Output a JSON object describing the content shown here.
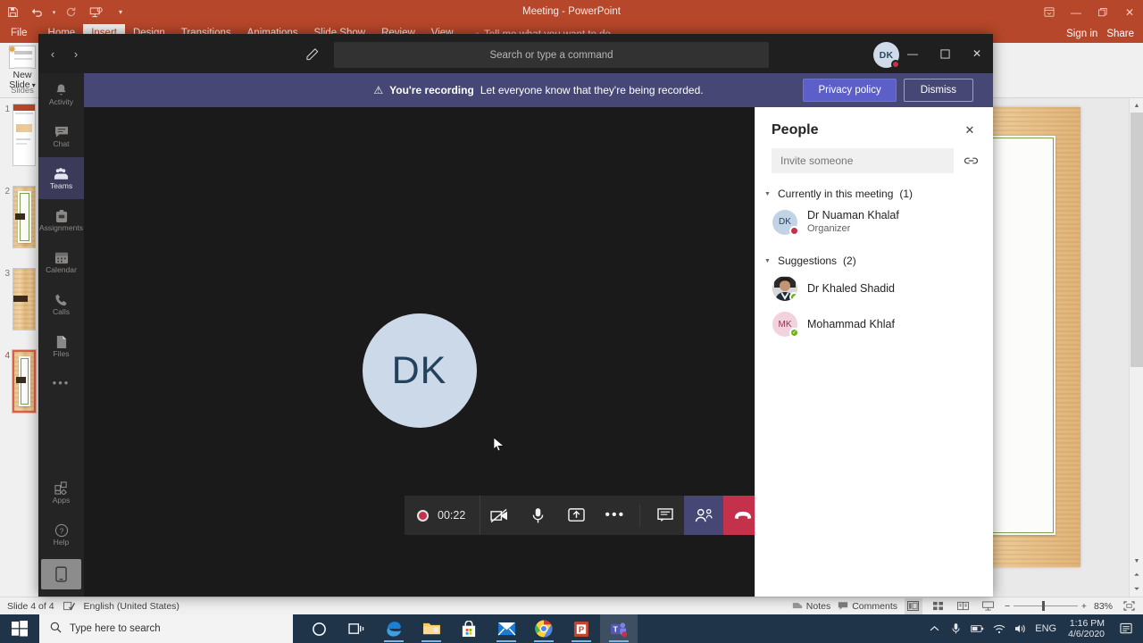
{
  "powerpoint": {
    "title": "Meeting - PowerPoint",
    "quick_access": [
      "save-icon",
      "undo-icon",
      "redo-icon",
      "start-presentation-icon",
      "customize-qat-icon"
    ],
    "window_controls": [
      "ribbon-display-options-icon",
      "minimize-icon",
      "restore-icon",
      "close-icon"
    ],
    "ribbon_tabs": [
      {
        "label": "File",
        "active": false
      },
      {
        "label": "Home",
        "active": false
      },
      {
        "label": "Insert",
        "active": true
      },
      {
        "label": "Design",
        "active": false
      },
      {
        "label": "Transitions",
        "active": false
      },
      {
        "label": "Animations",
        "active": false
      },
      {
        "label": "Slide Show",
        "active": false
      },
      {
        "label": "Review",
        "active": false
      },
      {
        "label": "View",
        "active": false
      }
    ],
    "tell_me": "Tell me what you want to do...",
    "sign_in": "Sign in",
    "share": "Share",
    "new_slide_label_1": "New",
    "new_slide_label_2": "Slide",
    "slides_group_label": "Slides",
    "thumbnails": [
      {
        "number": "1",
        "selected": false
      },
      {
        "number": "2",
        "selected": false
      },
      {
        "number": "3",
        "selected": false
      },
      {
        "number": "4",
        "selected": true
      }
    ],
    "status": {
      "slide_counter": "Slide 4 of 4",
      "language": "English (United States)",
      "notes": "Notes",
      "comments": "Comments",
      "zoom_level": "83%",
      "view_buttons": [
        "normal-view-icon",
        "slide-sorter-icon",
        "reading-view-icon",
        "slideshow-icon"
      ],
      "zoom_out": "−",
      "zoom_in": "+",
      "fit_slide": "fit-to-window-icon"
    }
  },
  "teams": {
    "nav": {
      "back": "back-arrow-icon",
      "forward": "forward-arrow-icon",
      "compose": "compose-icon"
    },
    "search": {
      "placeholder": "Search or type a command",
      "value": ""
    },
    "avatar": {
      "initials": "DK",
      "presence": "busy"
    },
    "window_controls": [
      "minimize-icon",
      "maximize-icon",
      "close-icon"
    ],
    "recording_banner": {
      "warning_icon": "warning-icon",
      "bold_text": "You're recording",
      "text": "Let everyone know that they're being recorded.",
      "privacy_button": "Privacy policy",
      "dismiss_button": "Dismiss",
      "accent_color": "#464775",
      "privacy_button_color": "#5b5fc7"
    },
    "rail": [
      {
        "label": "Activity",
        "icon": "bell-icon",
        "active": false
      },
      {
        "label": "Chat",
        "icon": "chat-icon",
        "active": false
      },
      {
        "label": "Teams",
        "icon": "teams-icon",
        "active": true
      },
      {
        "label": "Assignments",
        "icon": "assignments-icon",
        "active": false
      },
      {
        "label": "Calendar",
        "icon": "calendar-icon",
        "active": false
      },
      {
        "label": "Calls",
        "icon": "phone-icon",
        "active": false
      },
      {
        "label": "Files",
        "icon": "files-icon",
        "active": false
      },
      {
        "label": "",
        "icon": "more-options-icon",
        "active": false
      }
    ],
    "rail_bottom": [
      {
        "label": "Apps",
        "icon": "apps-icon"
      },
      {
        "label": "Help",
        "icon": "help-icon"
      }
    ],
    "rail_tile_icon": "mobile-download-icon",
    "stage": {
      "avatar_initials": "DK"
    },
    "controls": {
      "recording_time": "00:22",
      "recording_indicator": "recording-dot-icon",
      "buttons": [
        {
          "name": "camera-off-button",
          "icon": "camera-off-icon"
        },
        {
          "name": "microphone-button",
          "icon": "microphone-icon"
        },
        {
          "name": "share-screen-button",
          "icon": "share-screen-icon"
        },
        {
          "name": "more-actions-button",
          "icon": "ellipsis-icon"
        },
        {
          "name": "chat-button",
          "icon": "conversation-icon"
        },
        {
          "name": "people-button",
          "icon": "people-icon"
        },
        {
          "name": "hangup-button",
          "icon": "hangup-icon"
        }
      ],
      "people_button_color": "#464775",
      "hangup_button_color": "#c4314b"
    },
    "people_panel": {
      "title": "People",
      "close_icon": "close-icon",
      "invite_placeholder": "Invite someone",
      "invite_value": "",
      "share_link_icon": "share-link-icon",
      "sections": [
        {
          "label": "Currently in this meeting",
          "count": "(1)",
          "people": [
            {
              "name": "Dr Nuaman Khalaf",
              "role": "Organizer",
              "initials": "DK",
              "avatar_type": "initials-blue",
              "presence": "busy"
            }
          ]
        },
        {
          "label": "Suggestions",
          "count": "(2)",
          "people": [
            {
              "name": "Dr Khaled Shadid",
              "role": "",
              "initials": "",
              "avatar_type": "photo",
              "presence": "available"
            },
            {
              "name": "Mohammad Khlaf",
              "role": "",
              "initials": "MK",
              "avatar_type": "initials-pink",
              "presence": "available"
            }
          ]
        }
      ]
    }
  },
  "taskbar": {
    "start_icon": "windows-start-icon",
    "search_placeholder": "Type here to search",
    "search_icon": "search-icon",
    "icons": [
      {
        "name": "cortana-icon"
      },
      {
        "name": "task-view-icon"
      },
      {
        "name": "edge-icon"
      },
      {
        "name": "file-explorer-icon"
      },
      {
        "name": "microsoft-store-icon"
      },
      {
        "name": "mail-icon"
      },
      {
        "name": "chrome-icon"
      },
      {
        "name": "powerpoint-icon"
      },
      {
        "name": "teams-icon"
      }
    ],
    "tray": {
      "show_hidden": "chevron-up-icon",
      "items": [
        "microphone-icon",
        "battery-icon",
        "wifi-icon",
        "volume-icon"
      ],
      "language": "ENG",
      "time": "1:16 PM",
      "date": "4/6/2020",
      "action_center": "action-center-icon"
    }
  }
}
